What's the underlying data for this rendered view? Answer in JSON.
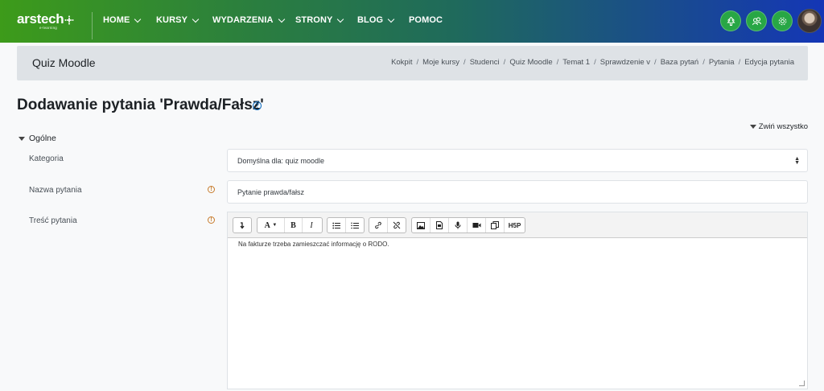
{
  "brand": {
    "name": "arstech",
    "sub": "e-learning"
  },
  "nav": {
    "items": [
      {
        "label": "HOME",
        "dropdown": true
      },
      {
        "label": "KURSY",
        "dropdown": true
      },
      {
        "label": "WYDARZENIA",
        "dropdown": true
      },
      {
        "label": "STRONY",
        "dropdown": true
      },
      {
        "label": "BLOG",
        "dropdown": true
      },
      {
        "label": "POMOC",
        "dropdown": false
      }
    ],
    "action_icons": [
      "tree-icon",
      "users-icon",
      "gear-icon"
    ]
  },
  "header": {
    "course_title": "Quiz Moodle",
    "breadcrumb": [
      "Kokpit",
      "Moje kursy",
      "Studenci",
      "Quiz Moodle",
      "Temat 1",
      "Sprawdzenie v",
      "Baza pytań",
      "Pytania",
      "Edycja pytania"
    ]
  },
  "page": {
    "title": "Dodawanie pytania 'Prawda/Fałsz'",
    "collapse_all": "Zwiń wszystko",
    "section": "Ogólne"
  },
  "form": {
    "category_label": "Kategoria",
    "category_value": "Domyślna dla: quiz moodle",
    "name_label": "Nazwa pytania",
    "name_value": "Pytanie prawda/fałsz",
    "text_label": "Treść pytania",
    "text_value": "Na fakturze trzeba zamieszczać informację o RODO."
  },
  "toolbar": {
    "bold": "B",
    "italic": "I",
    "font": "A",
    "h5p": "H5P"
  },
  "colors": {
    "nav_green": "#3d9b1a",
    "nav_blue": "#1436b6",
    "action_green": "#28a745",
    "required": "#c77b2b"
  }
}
